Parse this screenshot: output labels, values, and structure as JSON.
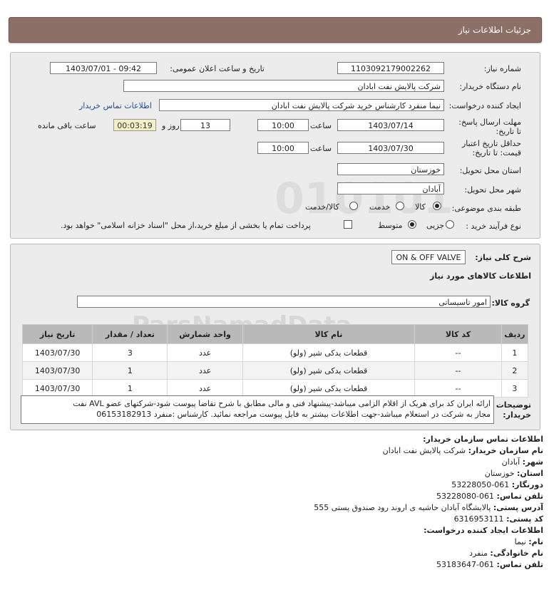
{
  "header": {
    "title": "جزئیات اطلاعات نیاز"
  },
  "form": {
    "need_number_label": "شماره نیاز:",
    "need_number": "1103092179002262",
    "announce_label": "تاریخ و ساعت اعلان عمومی:",
    "announce_value": "1403/07/01 - 09:42",
    "buyer_org_label": "نام دستگاه خریدار:",
    "buyer_org": "شرکت پالایش نفت ابادان",
    "creator_label": "ایجاد کننده درخواست:",
    "creator": "نیما منفرد کارشناس خرید شرکت پالایش نفت ابادان",
    "contact_link": "اطلاعات تماس خریدار",
    "deadline_label": "مهلت ارسال پاسخ: تا تاریخ:",
    "deadline_date": "1403/07/14",
    "time_label": "ساعت",
    "deadline_time": "10:00",
    "days": "13",
    "days_label": "روز و",
    "remaining": "00:03:19",
    "remaining_label": "ساعت باقی مانده",
    "validity_label": "حداقل تاریخ اعتبار قیمت: تا تاریخ:",
    "validity_date": "1403/07/30",
    "validity_time": "10:00",
    "province_label": "استان محل تحویل:",
    "province": "خوزستان",
    "city_label": "شهر محل تحویل:",
    "city": "آبادان",
    "category_label": "طبقه بندی موضوعی:",
    "category_options": [
      "کالا",
      "خدمت",
      "کالا/خدمت"
    ],
    "category_selected": "کالا",
    "process_label": "نوع فرآیند خرید :",
    "process_options": [
      "جزیی",
      "متوسط"
    ],
    "process_selected": "متوسط",
    "payment_text": "پرداخت تمام یا بخشی از مبلغ خرید،از محل \"اسناد خزانه اسلامی\" خواهد بود."
  },
  "details": {
    "summary_label": "شرح کلی نیاز:",
    "summary": "ON & OFF VALVE",
    "goods_info_title": "اطلاعات کالاهای مورد نیاز",
    "goods_group_label": "گروه کالا:",
    "goods_group": "امور تاسیساتی",
    "table": {
      "headers": [
        "ردیف",
        "کد کالا",
        "نام کالا",
        "واحد شمارش",
        "تعداد / مقدار",
        "تاریخ نیاز"
      ],
      "rows": [
        [
          "1",
          "--",
          "قطعات یدکی شیر (ولو)",
          "عدد",
          "3",
          "1403/07/30"
        ],
        [
          "2",
          "--",
          "قطعات یدکی شیر (ولو)",
          "عدد",
          "1",
          "1403/07/30"
        ],
        [
          "3",
          "--",
          "قطعات یدکی شیر (ولو)",
          "عدد",
          "1",
          "1403/07/30"
        ]
      ]
    },
    "buyer_notes_label": "توضیحات خریدار:",
    "buyer_notes_line1": "ارائه ایران کد برای هریک از اقلام الزامی میباشد-پیشنهاد فنی و مالی مطابق با شرح تقاضا پیوست شود-شرکتهای عضو AVL نفت",
    "buyer_notes_line2": "مجاز به شرکت در استعلام میباشد-جهت اطلاعات بیشتر به فایل پیوست مراجعه نمائید. کارشناس :منفرد 06153182913"
  },
  "contact": {
    "title": "اطلاعات تماس سازمان خریدار:",
    "org_label": "نام سازمان خریدار:",
    "org": "شرکت پالایش نفت ابادان",
    "city_label": "شهر:",
    "city": "آبادان",
    "province_label": "استان:",
    "province": "خوزستان",
    "fax_label": "دورنگار:",
    "fax": "061-53228050",
    "phone_label": "تلفن تماس:",
    "phone": "061-53228080",
    "address_label": "آدرس پستی:",
    "address": "پالایشگاه آبادان حاشیه ی اروند رود صندوق پستی 555",
    "postal_label": "کد پستی:",
    "postal": "6316953111",
    "creator_title": "اطلاعات ایجاد کننده درخواست:",
    "name_label": "نام:",
    "name": "نیما",
    "family_label": "نام خانوادگی:",
    "family": "منفرد",
    "creator_phone_label": "تلفن تماس:",
    "creator_phone": "061-53183647"
  }
}
